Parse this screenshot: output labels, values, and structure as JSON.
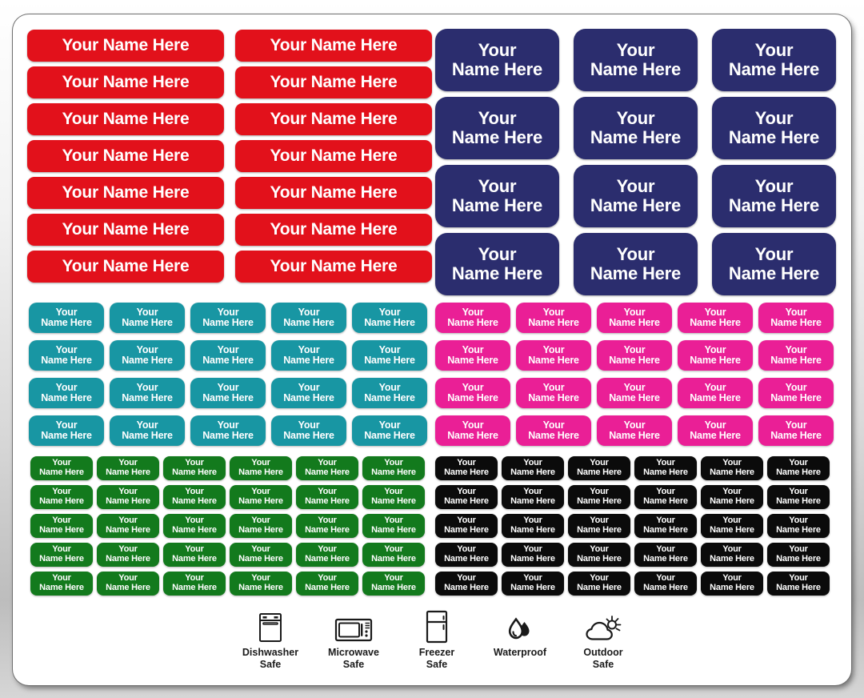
{
  "sheet": {
    "label_text": {
      "line1": "Your",
      "line2": "Name Here",
      "full": "Your Name Here"
    }
  },
  "label_groups": [
    {
      "id": "red",
      "name": "red-name-labels",
      "color": "#e2111b",
      "text_color": "#ffffff",
      "columns": 2,
      "rows": 7,
      "count": 14,
      "lines": 1,
      "text": "Your Name Here"
    },
    {
      "id": "navy",
      "name": "navy-name-labels",
      "color": "#2b2d6e",
      "text_color": "#ffffff",
      "columns": 3,
      "rows": 4,
      "count": 12,
      "lines": 2,
      "line1": "Your",
      "line2": "Name Here"
    },
    {
      "id": "teal",
      "name": "teal-name-labels",
      "color": "#1896a3",
      "text_color": "#ffffff",
      "columns": 5,
      "rows": 4,
      "count": 20,
      "lines": 2,
      "line1": "Your",
      "line2": "Name Here"
    },
    {
      "id": "pink",
      "name": "pink-name-labels",
      "color": "#ea1f96",
      "text_color": "#ffffff",
      "columns": 5,
      "rows": 4,
      "count": 20,
      "lines": 2,
      "line1": "Your",
      "line2": "Name Here"
    },
    {
      "id": "green",
      "name": "green-name-labels",
      "color": "#137a1d",
      "text_color": "#ffffff",
      "columns": 6,
      "rows": 5,
      "count": 30,
      "lines": 2,
      "line1": "Your",
      "line2": "Name Here"
    },
    {
      "id": "black",
      "name": "black-name-labels",
      "color": "#0b0b0b",
      "text_color": "#ffffff",
      "columns": 6,
      "rows": 5,
      "count": 30,
      "lines": 2,
      "line1": "Your",
      "line2": "Name Here"
    }
  ],
  "features": [
    {
      "icon": "dishwasher-icon",
      "line1": "Dishwasher",
      "line2": "Safe"
    },
    {
      "icon": "microwave-icon",
      "line1": "Microwave",
      "line2": "Safe"
    },
    {
      "icon": "freezer-icon",
      "line1": "Freezer",
      "line2": "Safe"
    },
    {
      "icon": "water-drop-icon",
      "line1": "Waterproof",
      "line2": ""
    },
    {
      "icon": "outdoor-sun-cloud-icon",
      "line1": "Outdoor",
      "line2": "Safe"
    }
  ]
}
